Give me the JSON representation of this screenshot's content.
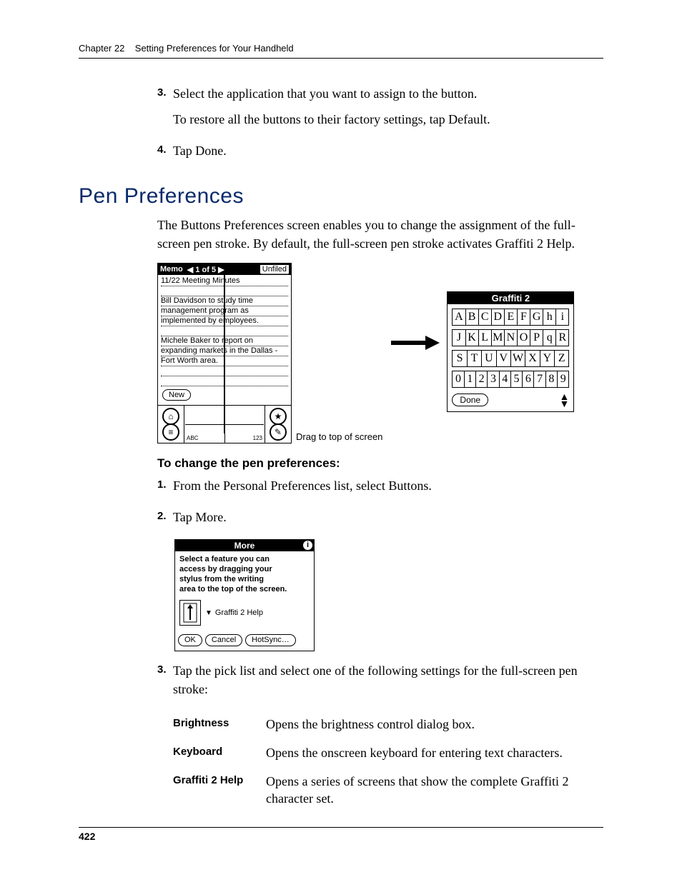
{
  "header": {
    "chapter": "Chapter 22",
    "title": "Setting Preferences for Your Handheld"
  },
  "steps_top": {
    "s3_num": "3.",
    "s3_line1": "Select the application that you want to assign to the button.",
    "s3_line2": "To restore all the buttons to their factory settings, tap Default.",
    "s4_num": "4.",
    "s4_text": "Tap Done."
  },
  "section": {
    "title": "Pen Preferences",
    "intro": "The Buttons Preferences screen enables you to change the assignment of the full-screen pen stroke. By default, the full-screen pen stroke activates Graffiti 2 Help."
  },
  "memo": {
    "label": "Memo",
    "nav": "◀ 1 of 5 ▶",
    "category": "Unfiled",
    "lines": [
      "11/22 Meeting Minutes",
      "",
      "Bill Davidson to study time",
      "management program as",
      "implemented by employees.",
      "",
      "Michele Baker to report on",
      "expanding markets in the Dallas -",
      "Fort Worth area.",
      "",
      "",
      ""
    ],
    "new_btn": "New",
    "abc": "ABC",
    "num": "123"
  },
  "drag_caption": "Drag to top of screen",
  "graffiti": {
    "title": "Graffiti 2",
    "row1": [
      "A",
      "B",
      "C",
      "D",
      "E",
      "F",
      "G",
      "h",
      "i"
    ],
    "row2": [
      "J",
      "K",
      "L",
      "M",
      "N",
      "O",
      "P",
      "q",
      "R"
    ],
    "row3": [
      "S",
      "T",
      "U",
      "V",
      "W",
      "X",
      "Y",
      "Z"
    ],
    "row4": [
      "0",
      "1",
      "2",
      "3",
      "4",
      "5",
      "6",
      "7",
      "8",
      "9"
    ],
    "done": "Done"
  },
  "subhead": "To change the pen preferences:",
  "steps_mid": {
    "s1_num": "1.",
    "s1_text": "From the Personal Preferences list, select Buttons.",
    "s2_num": "2.",
    "s2_text": "Tap More."
  },
  "more": {
    "title": "More",
    "body_l1": "Select a feature you can",
    "body_l2": "access by dragging your",
    "body_l3": "stylus from the writing",
    "body_l4": "area to the top of the screen.",
    "dropdown": "Graffiti 2 Help",
    "ok": "OK",
    "cancel": "Cancel",
    "hotsync": "HotSync…"
  },
  "step3": {
    "num": "3.",
    "text": "Tap the pick list and select one of the following settings for the full-screen pen stroke:"
  },
  "settings": {
    "r1_term": "Brightness",
    "r1_desc": "Opens the brightness control dialog box.",
    "r2_term": "Keyboard",
    "r2_desc": "Opens the onscreen keyboard for entering text characters.",
    "r3_term": "Graffiti 2 Help",
    "r3_desc": "Opens a series of screens that show the complete Graffiti 2 character set."
  },
  "page_number": "422"
}
